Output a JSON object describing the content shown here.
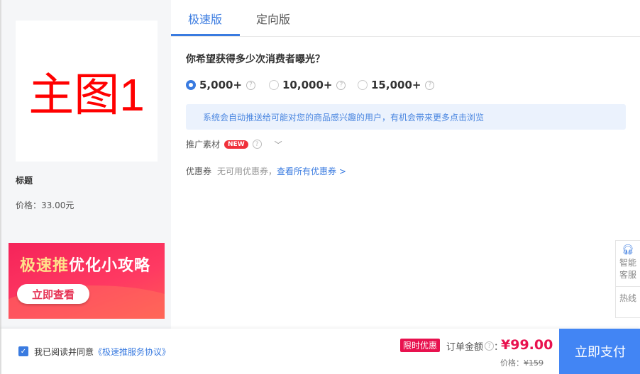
{
  "product": {
    "image_text": "主图1",
    "title": "标题",
    "price": "价格：33.00元"
  },
  "banner": {
    "title_highlight": "极速推",
    "title_rest": "优化小攻略",
    "button": "立即查看"
  },
  "tabs": [
    {
      "label": "极速版"
    },
    {
      "label": "定向版"
    }
  ],
  "question": "你希望获得多少次消费者曝光？",
  "options": [
    {
      "label": "5,000+",
      "selected": true
    },
    {
      "label": "10,000+",
      "selected": false
    },
    {
      "label": "15,000+",
      "selected": false
    }
  ],
  "info": "系统会自动推送给可能对您的商品感兴趣的用户，有机会带来更多点击浏览",
  "material": {
    "label": "推广素材",
    "badge": "NEW"
  },
  "coupon": {
    "label": "优惠券",
    "none": "无可用优惠券，",
    "link": "查看所有优惠券 >"
  },
  "side": {
    "service": "智能客服",
    "hotline": "热线"
  },
  "footer": {
    "agree_text": "我已阅读并同意",
    "agree_link": "《极速推服务协议》",
    "limit_badge": "限时优惠",
    "amount_label": "订单金额",
    "amount": "¥99.00",
    "orig_label": "价格：",
    "orig_price": "¥159",
    "pay": "立即支付"
  }
}
